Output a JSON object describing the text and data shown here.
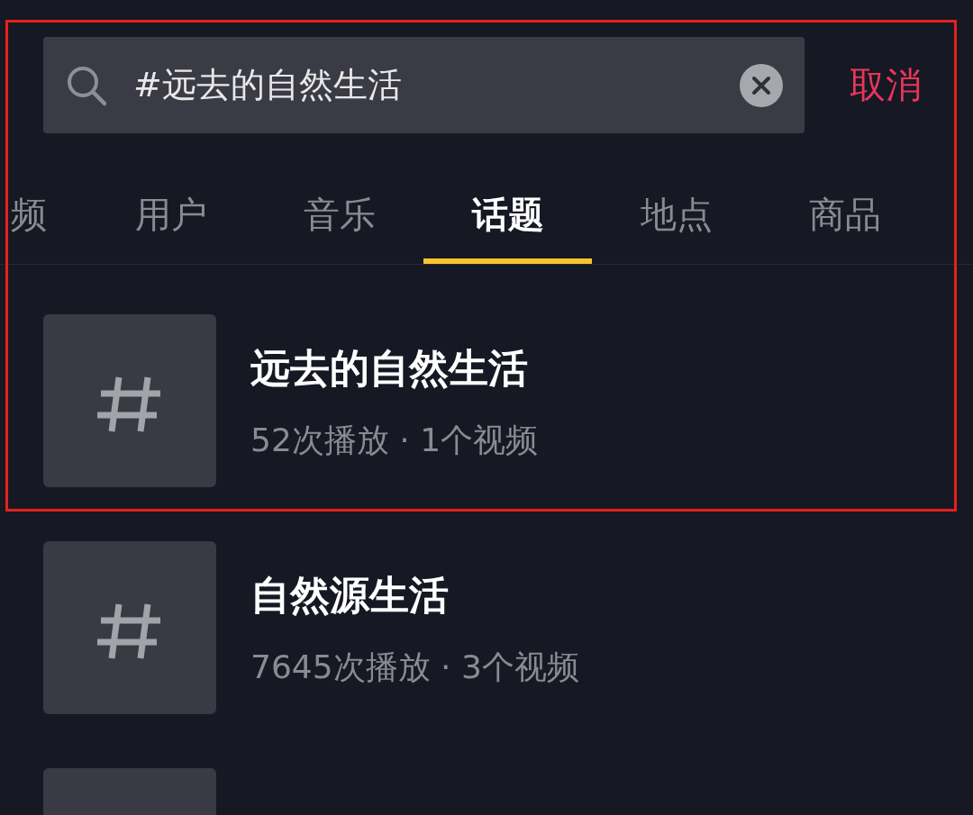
{
  "search": {
    "value": "#远去的自然生活",
    "cancel": "取消"
  },
  "tabs": [
    {
      "label": "频",
      "selected": false
    },
    {
      "label": "用户",
      "selected": false
    },
    {
      "label": "音乐",
      "selected": false
    },
    {
      "label": "话题",
      "selected": true
    },
    {
      "label": "地点",
      "selected": false
    },
    {
      "label": "商品",
      "selected": false
    }
  ],
  "results": [
    {
      "title": "远去的自然生活",
      "stats": "52次播放 · 1个视频"
    },
    {
      "title": "自然源生活",
      "stats": "7645次播放 · 3个视频"
    },
    {
      "cut_off": true
    }
  ],
  "annotation": {
    "kind": "highlight-frame"
  }
}
